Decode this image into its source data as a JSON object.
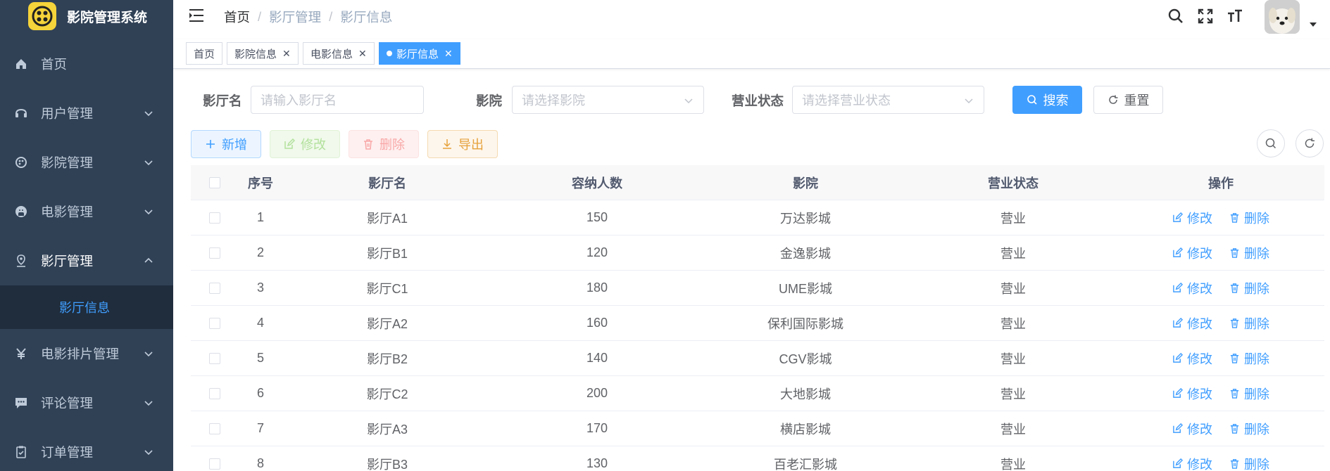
{
  "app": {
    "title": "影院管理系统"
  },
  "sidebar": {
    "items": [
      {
        "label": "首页"
      },
      {
        "label": "用户管理"
      },
      {
        "label": "影院管理"
      },
      {
        "label": "电影管理"
      },
      {
        "label": "影厅管理"
      },
      {
        "label": "电影排片管理"
      },
      {
        "label": "评论管理"
      },
      {
        "label": "订单管理"
      }
    ],
    "sub_item": "影厅信息"
  },
  "breadcrumb": [
    "首页",
    "影厅管理",
    "影厅信息"
  ],
  "tags": [
    {
      "label": "首页"
    },
    {
      "label": "影院信息"
    },
    {
      "label": "电影信息"
    },
    {
      "label": "影厅信息"
    }
  ],
  "search": {
    "hall_label": "影厅名",
    "hall_placeholder": "请输入影厅名",
    "cinema_label": "影院",
    "cinema_placeholder": "请选择影院",
    "status_label": "营业状态",
    "status_placeholder": "请选择营业状态",
    "search_btn": "搜索",
    "reset_btn": "重置"
  },
  "toolbar": {
    "add": "新增",
    "edit": "修改",
    "delete": "删除",
    "export": "导出"
  },
  "table": {
    "headers": [
      "序号",
      "影厅名",
      "容纳人数",
      "影院",
      "营业状态",
      "操作"
    ],
    "rows": [
      [
        "1",
        "影厅A1",
        "150",
        "万达影城",
        "营业"
      ],
      [
        "2",
        "影厅B1",
        "120",
        "金逸影城",
        "营业"
      ],
      [
        "3",
        "影厅C1",
        "180",
        "UME影城",
        "营业"
      ],
      [
        "4",
        "影厅A2",
        "160",
        "保利国际影城",
        "营业"
      ],
      [
        "5",
        "影厅B2",
        "140",
        "CGV影城",
        "营业"
      ],
      [
        "6",
        "影厅C2",
        "200",
        "大地影城",
        "营业"
      ],
      [
        "7",
        "影厅A3",
        "170",
        "横店影城",
        "营业"
      ],
      [
        "8",
        "影厅B3",
        "130",
        "百老汇影城",
        "营业"
      ]
    ],
    "op_edit": "修改",
    "op_delete": "删除"
  },
  "colors": {
    "primary": "#409eff",
    "sidebar_bg": "#304156",
    "submenu_bg": "#1f2d3d",
    "logo": "#f5d33a"
  }
}
